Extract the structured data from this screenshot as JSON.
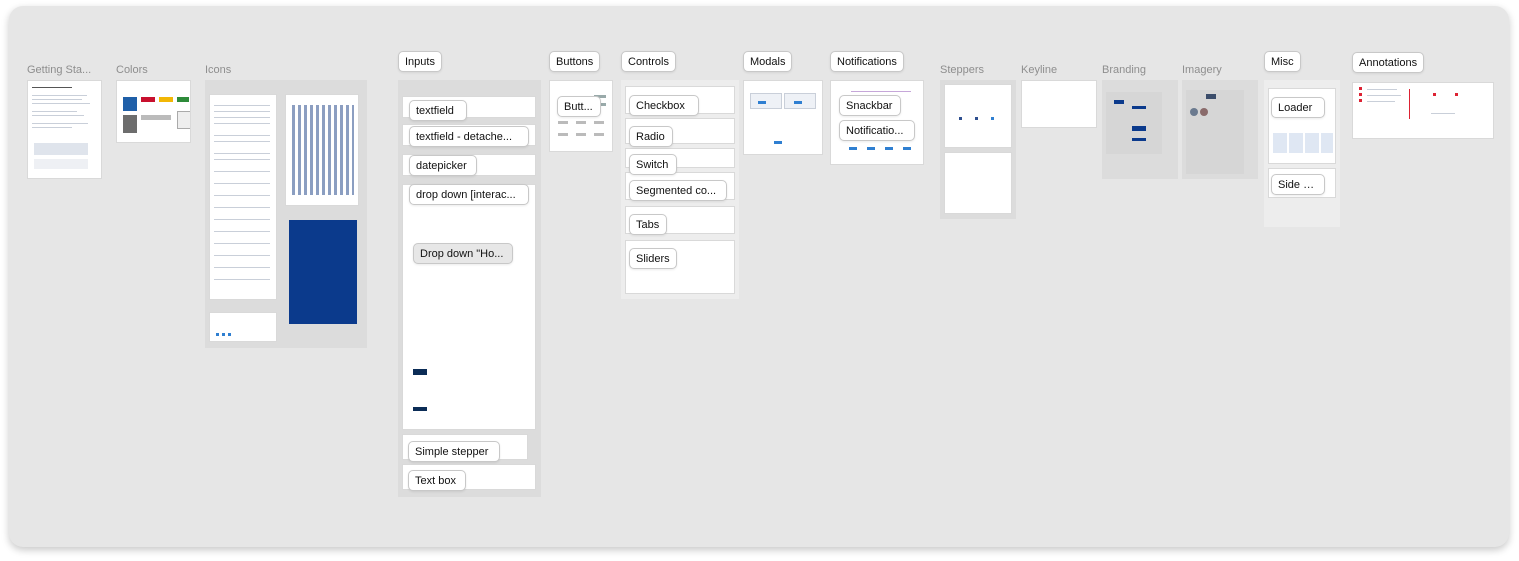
{
  "groups": {
    "getting_started": "Getting Sta...",
    "colors": "Colors",
    "icons": "Icons",
    "inputs": "Inputs",
    "buttons": "Buttons",
    "controls": "Controls",
    "modals": "Modals",
    "notifications": "Notifications",
    "steppers": "Steppers",
    "keyline": "Keyline",
    "branding": "Branding",
    "imagery": "Imagery",
    "misc": "Misc",
    "annotations": "Annotations"
  },
  "inputs_items": {
    "textfield": "textfield",
    "textfield_detached": "textfield - detache...",
    "datepicker": "datepicker",
    "drop_down": "drop down [interac...",
    "drop_down_ho": "Drop down \"Ho...",
    "simple_stepper": "Simple stepper",
    "text_box": "Text box"
  },
  "buttons_items": {
    "butt": "Butt..."
  },
  "controls_items": {
    "checkbox": "Checkbox",
    "radio": "Radio",
    "switch": "Switch",
    "segmented": "Segmented co...",
    "tabs": "Tabs",
    "sliders": "Sliders"
  },
  "notifications_items": {
    "snackbar": "Snackbar",
    "notification": "Notificatio..."
  },
  "misc_items": {
    "loader": "Loader",
    "side_nav": "Side n..."
  },
  "colors_accent": {
    "blue": "#1f5fa8",
    "red": "#c8102e",
    "yellow": "#f2b705",
    "green": "#2e8b3a",
    "navy": "#0b3a8c"
  }
}
